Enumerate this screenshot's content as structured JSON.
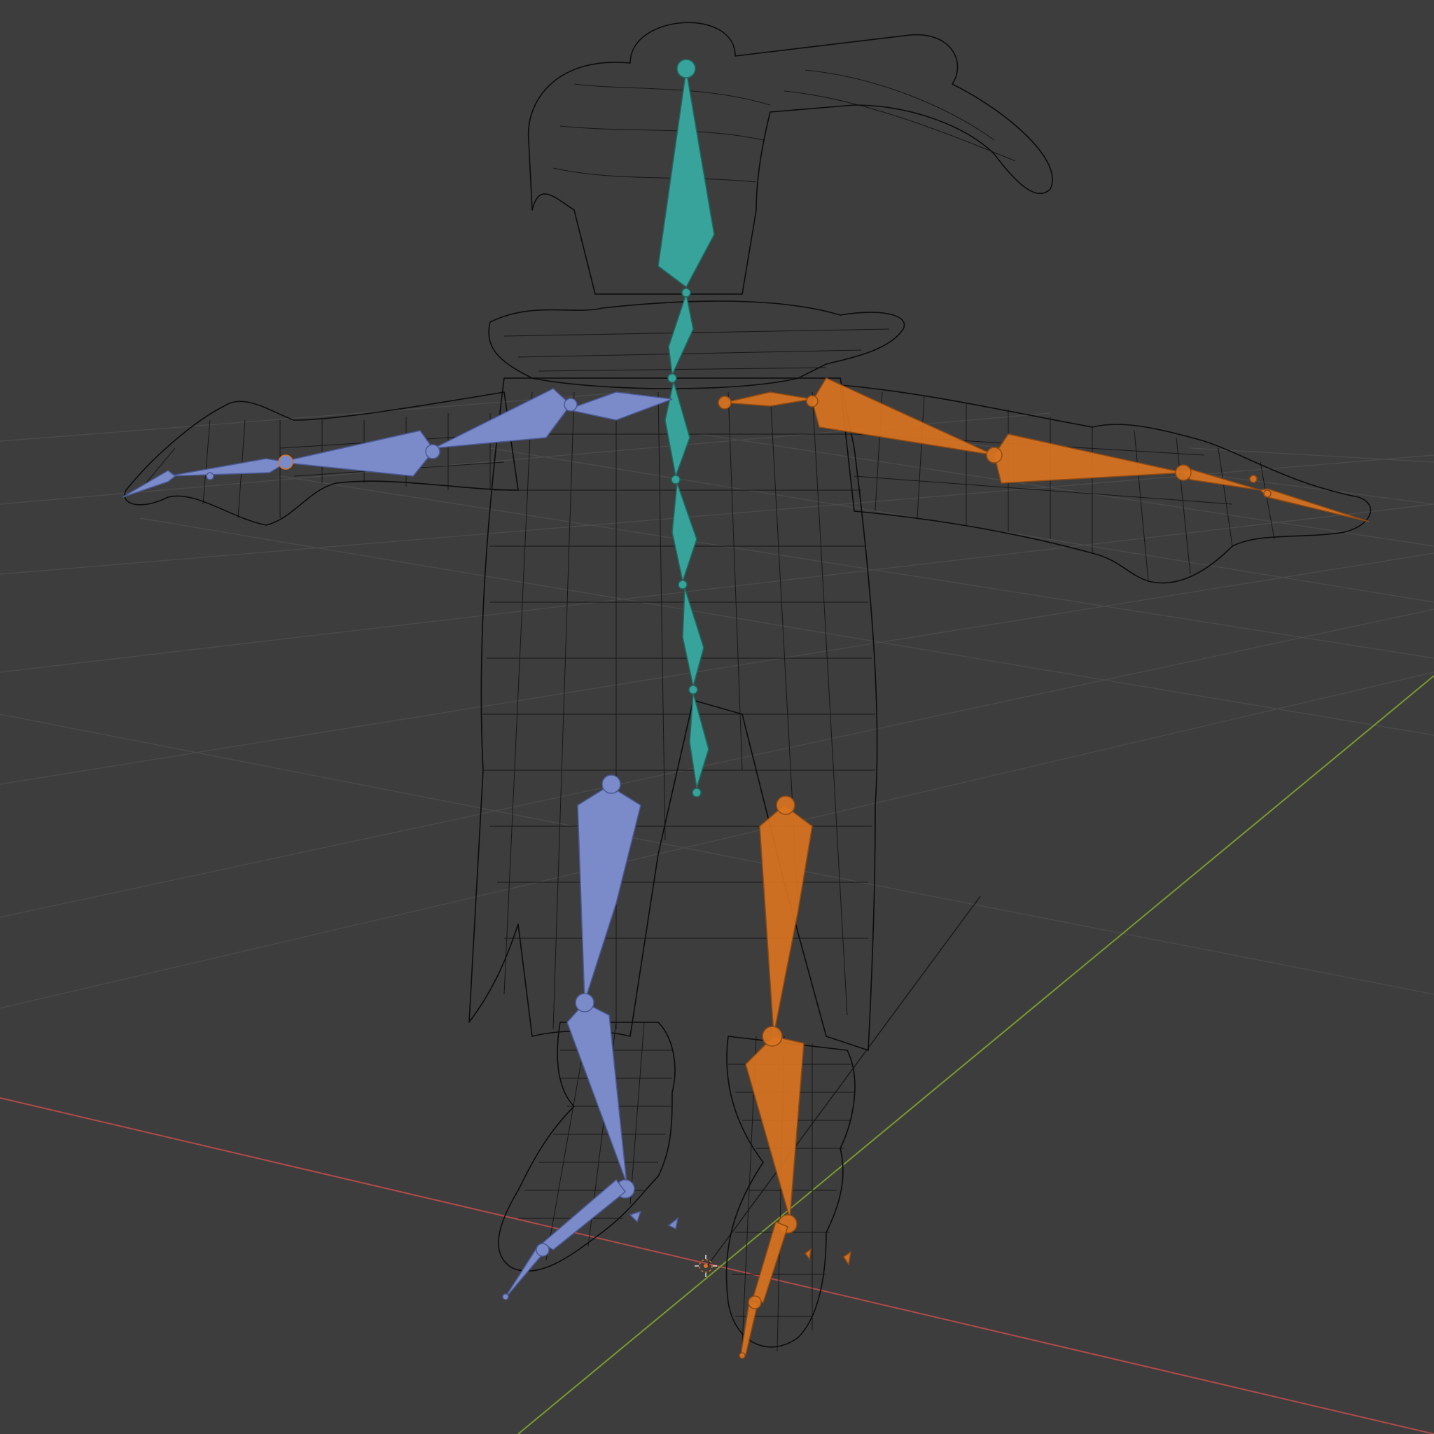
{
  "viewport": {
    "mode": "wireframe-armature",
    "background": "#3d3d3d",
    "grid_color": "#4a4a4a",
    "x_axis_color": "#b04a4a",
    "y_axis_color": "#7a9a2e",
    "mesh_color": "#0c0c0c"
  },
  "armature": {
    "colors": {
      "center": "#37a39a",
      "left": "#7b8bc9",
      "right": "#d9731f"
    },
    "bone_groups": [
      "center",
      "left",
      "right"
    ]
  },
  "icons": {
    "origin": "3d-cursor-icon"
  }
}
